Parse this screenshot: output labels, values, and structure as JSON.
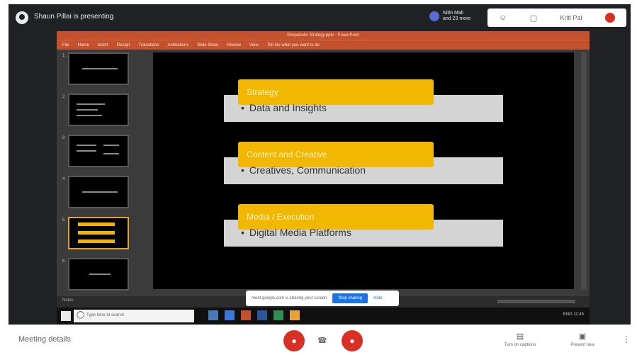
{
  "meet": {
    "presenting_text": "Shaun Pillai is presenting",
    "you_label_line1": "Nitin Mali",
    "you_label_line2": "and 23 more",
    "top_right_name": "Kriti Pal",
    "people_icon": "people-icon",
    "chat_icon": "chat-icon"
  },
  "powerpoint": {
    "doc_title": "Shopaholic Strategy.pptx - PowerPoint",
    "ribbon_tabs": [
      "File",
      "Home",
      "Insert",
      "Design",
      "Transitions",
      "Animations",
      "Slide Show",
      "Review",
      "View",
      "Tell me what you want to do"
    ],
    "thumbnails": [
      "1",
      "2",
      "3",
      "4",
      "5",
      "6"
    ],
    "notes_label": "Notes",
    "slide": {
      "rows": [
        {
          "heading": "Strategy",
          "bullet": "Data and Insights"
        },
        {
          "heading": "Content and Creative",
          "bullet": "Creatives, Communication"
        },
        {
          "heading": "Media / Execution",
          "bullet": "Digital Media Platforms"
        }
      ]
    }
  },
  "banner": {
    "text": "meet.google.com is sharing your screen",
    "stop_label": "Stop sharing",
    "hide_label": "Hide"
  },
  "taskbar": {
    "search_placeholder": "Type here to search",
    "tray_text": "ENG 11:45"
  },
  "bottom": {
    "meeting_details": "Meeting details",
    "turn_on_captions": "Turn on captions",
    "present_now": "Present now"
  },
  "colors": {
    "accent_gold": "#f2b700",
    "ppt_orange": "#c4512d",
    "end_red": "#d93025"
  }
}
